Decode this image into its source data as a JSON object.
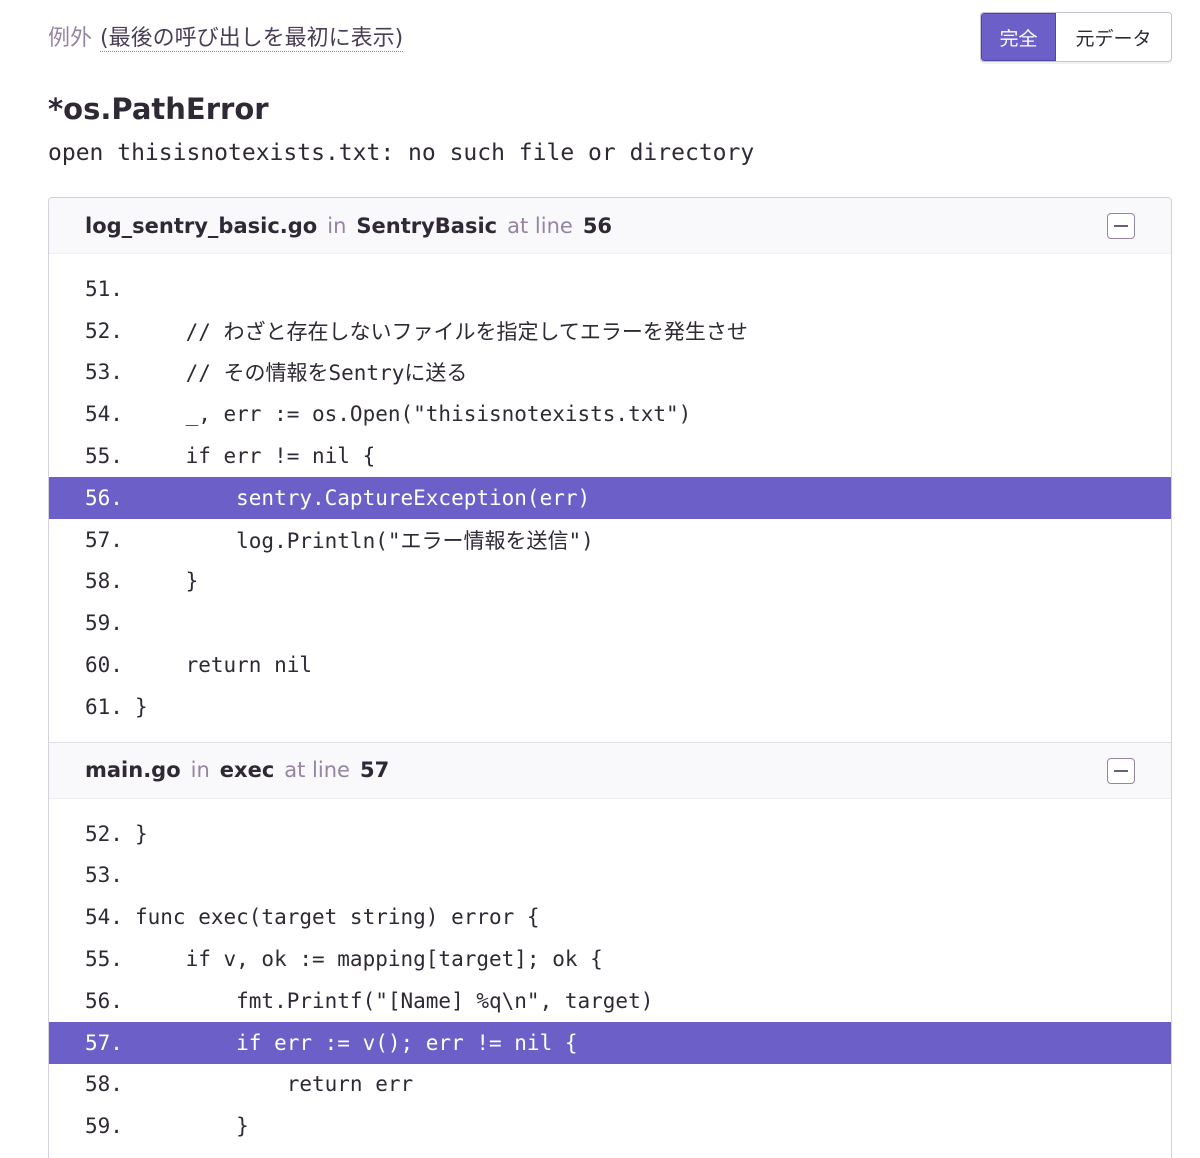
{
  "header": {
    "title": "例外",
    "subtitle": "(最後の呼び出しを最初に表示)"
  },
  "toggle": {
    "full_label": "完全",
    "raw_label": "元データ"
  },
  "exception": {
    "type": "*os.PathError",
    "value": "open thisisnotexists.txt: no such file or directory"
  },
  "frames": [
    {
      "filename": "log_sentry_basic.go",
      "in_label": "in",
      "function": "SentryBasic",
      "at_line_label": "at line",
      "line": "56",
      "lines": [
        {
          "num": "51.",
          "code": ""
        },
        {
          "num": "52.",
          "code": "    // わざと存在しないファイルを指定してエラーを発生させ"
        },
        {
          "num": "53.",
          "code": "    // その情報をSentryに送る"
        },
        {
          "num": "54.",
          "code": "    _, err := os.Open(\"thisisnotexists.txt\")"
        },
        {
          "num": "55.",
          "code": "    if err != nil {"
        },
        {
          "num": "56.",
          "code": "        sentry.CaptureException(err)"
        },
        {
          "num": "57.",
          "code": "        log.Println(\"エラー情報を送信\")"
        },
        {
          "num": "58.",
          "code": "    }"
        },
        {
          "num": "59.",
          "code": ""
        },
        {
          "num": "60.",
          "code": "    return nil"
        },
        {
          "num": "61.",
          "code": "}"
        }
      ],
      "active_index": 5
    },
    {
      "filename": "main.go",
      "in_label": "in",
      "function": "exec",
      "at_line_label": "at line",
      "line": "57",
      "lines": [
        {
          "num": "52.",
          "code": "}"
        },
        {
          "num": "53.",
          "code": ""
        },
        {
          "num": "54.",
          "code": "func exec(target string) error {"
        },
        {
          "num": "55.",
          "code": "    if v, ok := mapping[target]; ok {"
        },
        {
          "num": "56.",
          "code": "        fmt.Printf(\"[Name] %q\\n\", target)"
        },
        {
          "num": "57.",
          "code": "        if err := v(); err != nil {"
        },
        {
          "num": "58.",
          "code": "            return err"
        },
        {
          "num": "59.",
          "code": "        }"
        }
      ],
      "active_index": 5
    }
  ],
  "colors": {
    "accent": "#6c5fc7",
    "muted": "#9585a3"
  }
}
